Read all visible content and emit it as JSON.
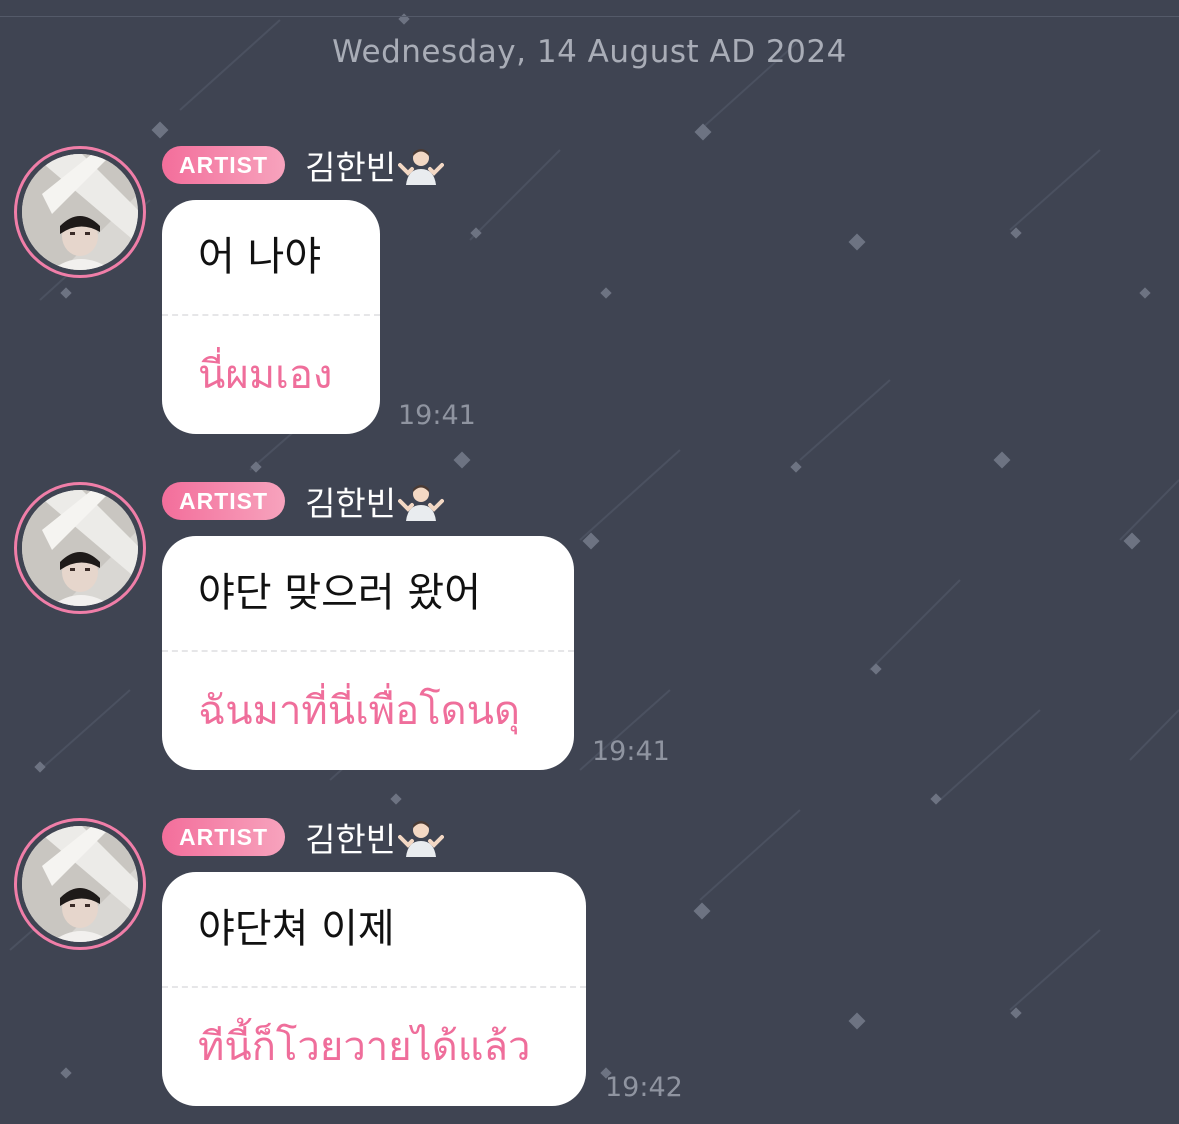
{
  "date_separator": "Wednesday, 14 August AD 2024",
  "colors": {
    "background": "#3f4452",
    "badge_start": "#f36e9b",
    "badge_end": "#f7a3bd",
    "translation_text": "#ef6e9b",
    "avatar_ring": "#f07ea8"
  },
  "messages": [
    {
      "badge": "ARTIST",
      "sender": "김한빈",
      "sender_emoji": "person-shrugging-emoji",
      "original": "어 나야",
      "translation": "นี่ผมเอง",
      "time": "19:41"
    },
    {
      "badge": "ARTIST",
      "sender": "김한빈",
      "sender_emoji": "person-shrugging-emoji",
      "original": "야단 맞으러 왔어",
      "translation": "ฉันมาที่นี่เพื่อโดนดุ",
      "time": "19:41"
    },
    {
      "badge": "ARTIST",
      "sender": "김한빈",
      "sender_emoji": "person-shrugging-emoji",
      "original": "야단쳐 이제",
      "translation": "ทีนี้ก็โวยวายได้แล้ว",
      "time": "19:42"
    }
  ]
}
